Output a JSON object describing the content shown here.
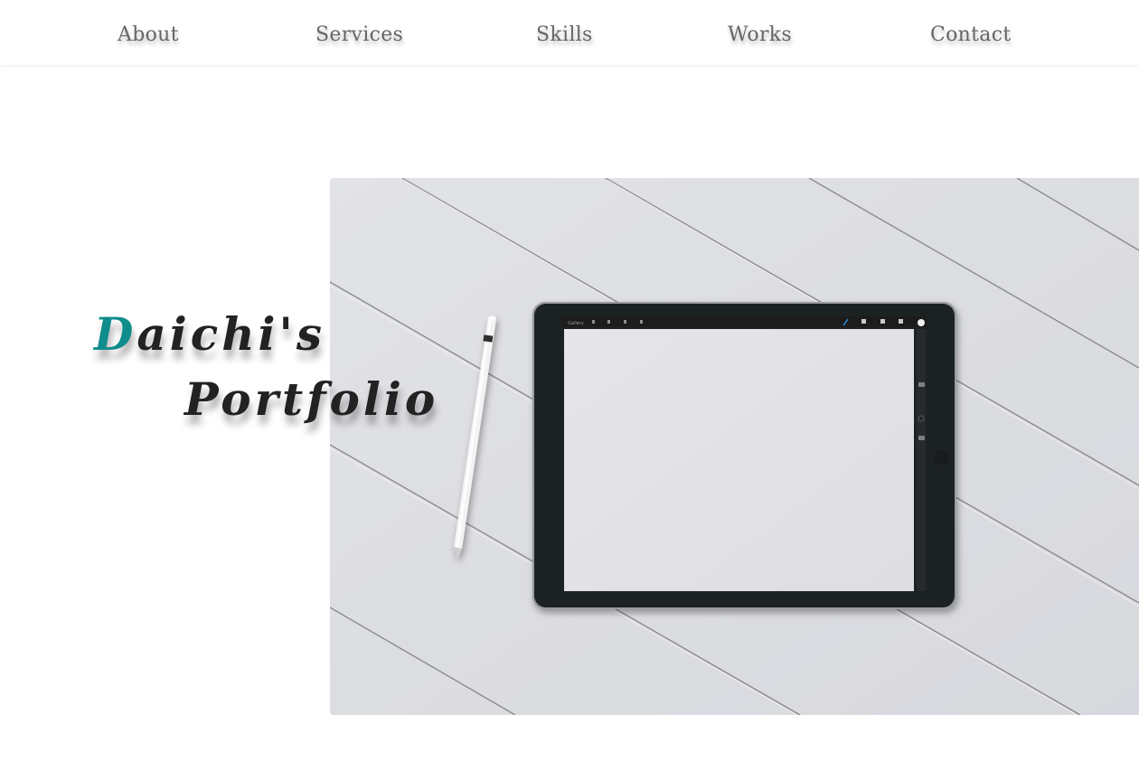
{
  "nav": {
    "items": [
      {
        "label": "About"
      },
      {
        "label": "Services"
      },
      {
        "label": "Skills"
      },
      {
        "label": "Works"
      },
      {
        "label": "Contact"
      }
    ]
  },
  "hero": {
    "title_initial": "D",
    "title_rest": "aichi's",
    "title_line_2": "Portfolio",
    "image_alt": "Tablet with stylus on white wooden desk",
    "tablet_app_label": "Gallery"
  },
  "colors": {
    "accent": "#0f8c8c",
    "text": "#222222",
    "nav_text": "#666666",
    "background": "#ffffff"
  }
}
